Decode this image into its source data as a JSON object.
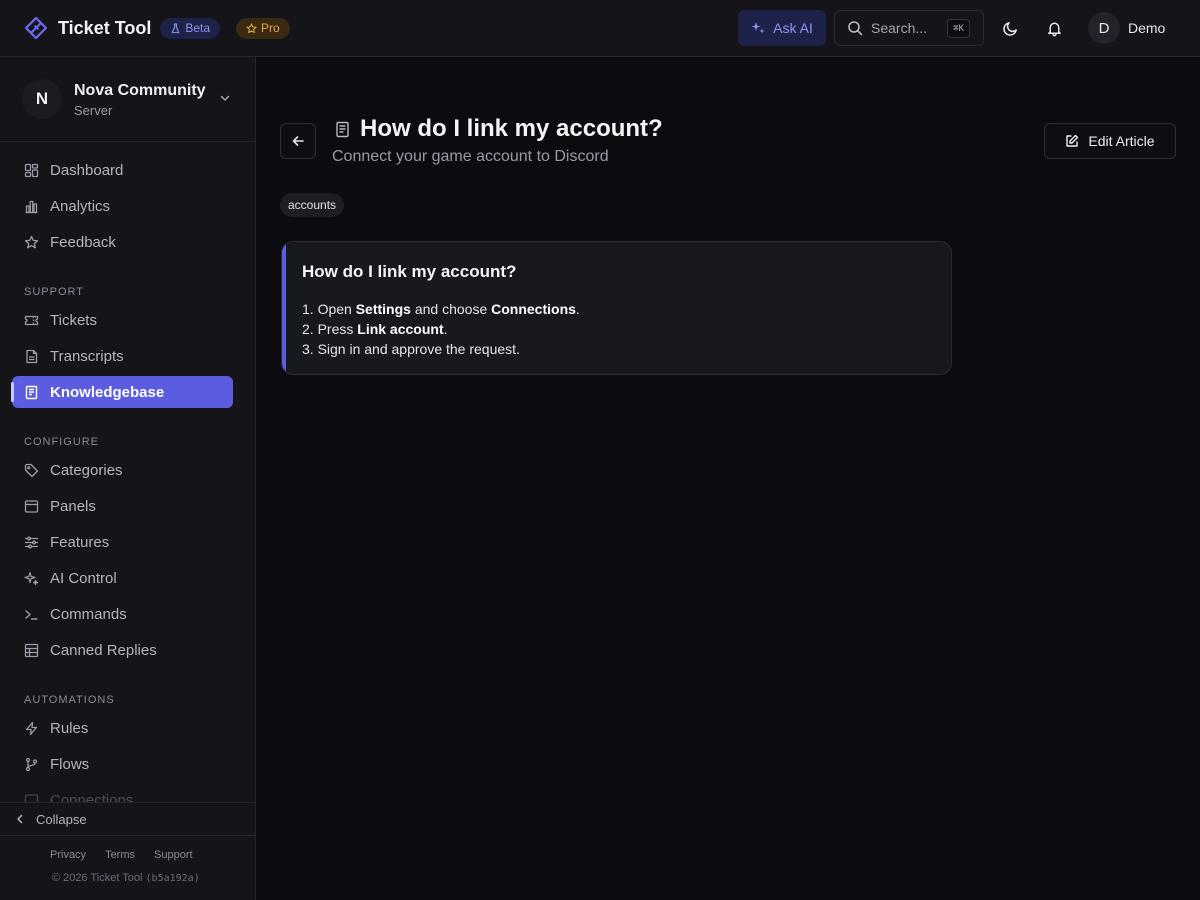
{
  "app": {
    "name": "Ticket Tool",
    "beta_label": "Beta",
    "pro_label": "Pro",
    "accent_color": "#5b5ce0"
  },
  "topbar": {
    "ask_ai_label": "Ask AI",
    "search_placeholder": "Search...",
    "search_shortcut": "⌘K",
    "theme_icon": "moon-icon",
    "notifications_icon": "bell-icon",
    "user_initial": "D",
    "user_name": "Demo"
  },
  "server": {
    "initial": "N",
    "name": "Nova Community",
    "type": "Server"
  },
  "sidebar": {
    "top_items": [
      {
        "label": "Dashboard",
        "icon": "dashboard-icon"
      },
      {
        "label": "Analytics",
        "icon": "bar-chart-icon"
      },
      {
        "label": "Feedback",
        "icon": "star-icon"
      }
    ],
    "sections": [
      {
        "label": "SUPPORT",
        "items": [
          {
            "label": "Tickets",
            "icon": "ticket-icon"
          },
          {
            "label": "Transcripts",
            "icon": "file-text-icon"
          },
          {
            "label": "Knowledgebase",
            "icon": "book-icon",
            "active": true
          }
        ]
      },
      {
        "label": "CONFIGURE",
        "items": [
          {
            "label": "Categories",
            "icon": "tag-icon"
          },
          {
            "label": "Panels",
            "icon": "panel-icon"
          },
          {
            "label": "Features",
            "icon": "sliders-icon"
          },
          {
            "label": "AI Control",
            "icon": "sparkles-icon"
          },
          {
            "label": "Commands",
            "icon": "terminal-icon"
          },
          {
            "label": "Canned Replies",
            "icon": "list-icon"
          }
        ]
      },
      {
        "label": "AUTOMATIONS",
        "items": [
          {
            "label": "Rules",
            "icon": "bolt-icon"
          },
          {
            "label": "Flows",
            "icon": "git-branch-icon"
          },
          {
            "label": "Connections",
            "icon": "link-icon"
          }
        ]
      }
    ],
    "collapse_label": "Collapse",
    "footer_links": [
      "Privacy",
      "Terms",
      "Support"
    ],
    "copyright": "© 2026 Ticket Tool",
    "build_hash": "(b5a192a)"
  },
  "article": {
    "title": "How do I link my account?",
    "subtitle": "Connect your game account to Discord",
    "edit_label": "Edit Article",
    "tag": "accounts",
    "card_title": "How do I link my account?",
    "steps": [
      {
        "num": "1.",
        "parts": [
          {
            "t": " Open "
          },
          {
            "t": "Settings",
            "b": true
          },
          {
            "t": " and choose "
          },
          {
            "t": "Connections",
            "b": true
          },
          {
            "t": "."
          }
        ]
      },
      {
        "num": "2.",
        "parts": [
          {
            "t": " Press "
          },
          {
            "t": "Link account",
            "b": true
          },
          {
            "t": "."
          }
        ]
      },
      {
        "num": "3.",
        "parts": [
          {
            "t": " Sign in and approve the request."
          }
        ]
      }
    ]
  }
}
